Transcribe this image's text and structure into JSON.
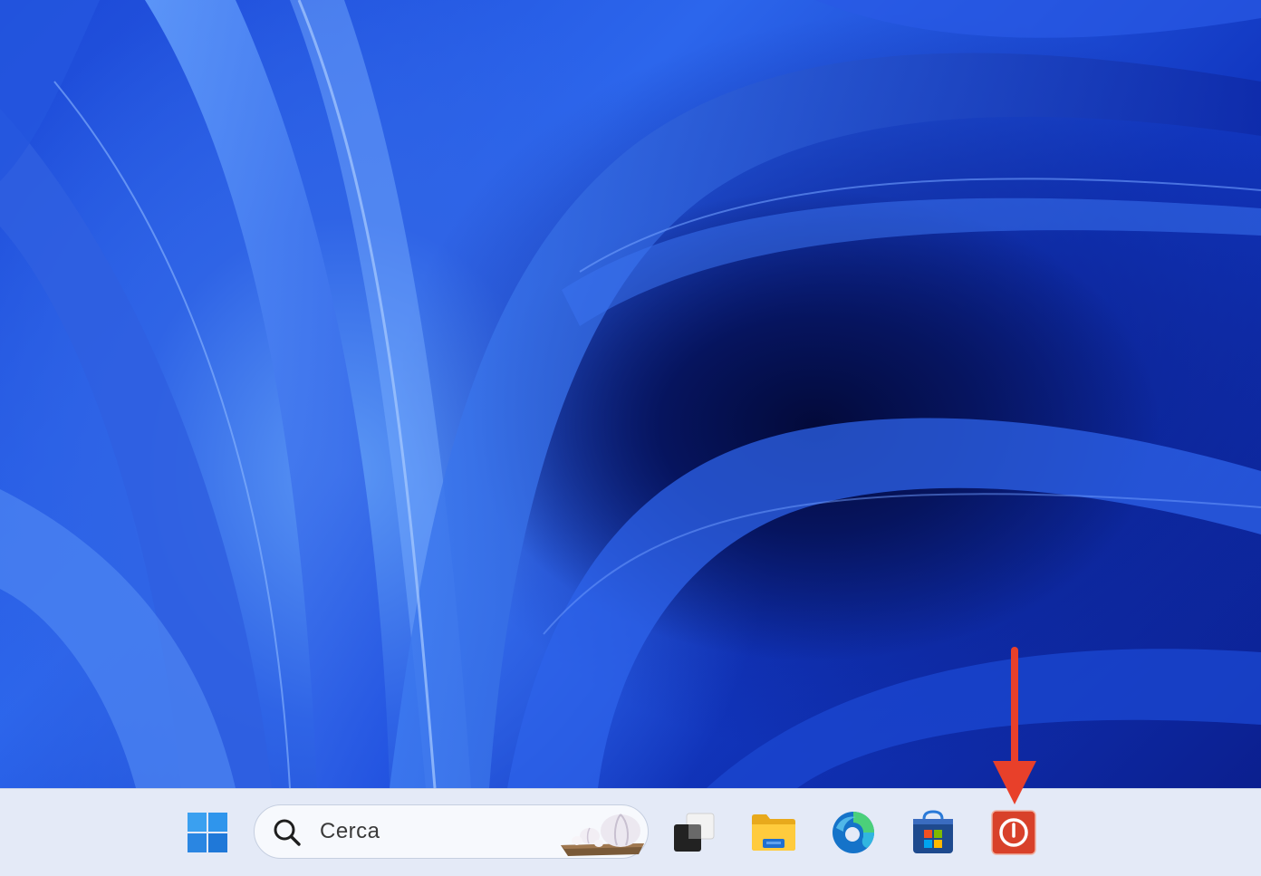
{
  "desktop": {
    "wallpaper": "blue-swirl-wallpaper"
  },
  "taskbar": {
    "start_icon": "windows-start-icon",
    "search": {
      "placeholder": "Cerca",
      "icon": "search-icon",
      "highlight_icon": "garlic-highlight-icon"
    },
    "apps": [
      {
        "name": "task-view-icon"
      },
      {
        "name": "file-explorer-icon"
      },
      {
        "name": "edge-icon"
      },
      {
        "name": "microsoft-store-icon"
      },
      {
        "name": "power-app-icon"
      }
    ]
  },
  "annotation": {
    "type": "arrow",
    "color": "#e8402a",
    "target": "power-app-icon"
  },
  "colors": {
    "taskbar_bg": "#e4eaf7",
    "accent_red": "#e8402a",
    "start_blue": "#2a8ee6"
  }
}
